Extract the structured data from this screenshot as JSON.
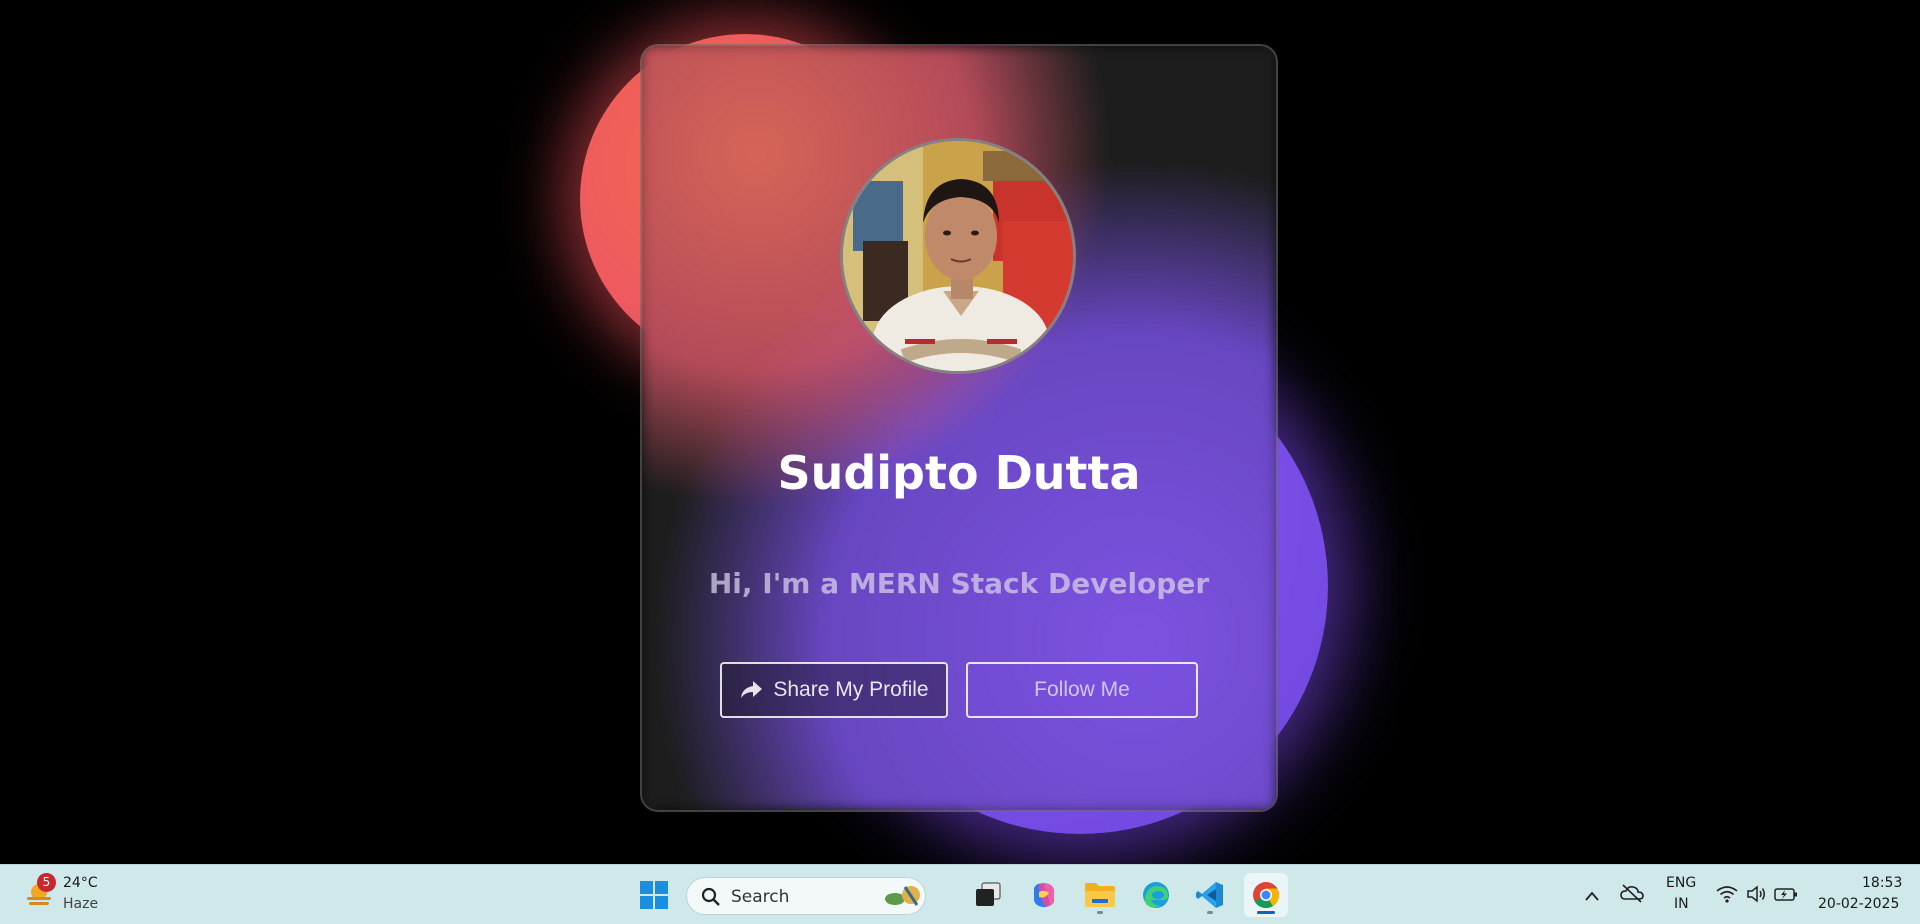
{
  "profile_card": {
    "name": "Sudipto Dutta",
    "tagline": "Hi, I'm a MERN Stack Developer",
    "share_button_label": "Share My Profile",
    "follow_button_label": "Follow Me",
    "accent_colors": {
      "red_blob": "#ee5a5f",
      "purple_blob": "#7a4ee6",
      "card_background": "#1d1d1d"
    }
  },
  "taskbar": {
    "weather": {
      "badge_count": "5",
      "temperature": "24°C",
      "condition": "Haze"
    },
    "search": {
      "placeholder": "Search"
    },
    "pinned_apps": [
      "windows-start-icon",
      "search",
      "task-view-icon",
      "copilot-icon",
      "file-explorer-icon",
      "edge-icon",
      "vscode-icon",
      "chrome-icon"
    ],
    "tray": {
      "language_line1": "ENG",
      "language_line2": "IN",
      "time": "18:53",
      "date": "20-02-2025"
    }
  }
}
